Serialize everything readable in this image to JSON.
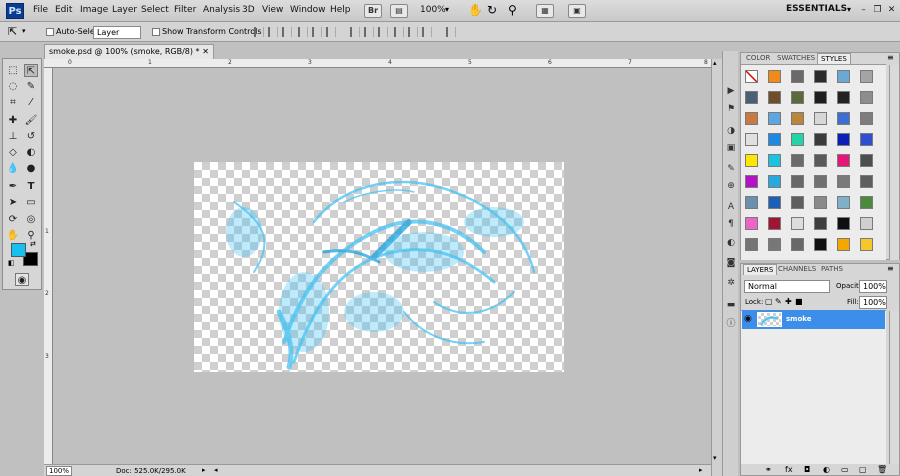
{
  "app": {
    "logo": "Ps"
  },
  "menus": [
    "File",
    "Edit",
    "Image",
    "Layer",
    "Select",
    "Filter",
    "Analysis",
    "3D",
    "View",
    "Window",
    "Help"
  ],
  "appbar": {
    "bridge": "Br",
    "zoom": "100%",
    "workspace": "ESSENTIALS"
  },
  "window_controls": {
    "minimize": "–",
    "restore": "❐",
    "close": "✕"
  },
  "options": {
    "auto_select_label": "Auto-Select:",
    "auto_select_target": "Layer",
    "show_transform_label": "Show Transform Controls"
  },
  "document": {
    "tab_label": "smoke.psd @ 100% (smoke, RGB/8) *"
  },
  "ruler": {
    "h_ticks": [
      "0",
      "1",
      "2",
      "3",
      "4",
      "5",
      "6",
      "7",
      "8"
    ],
    "v_ticks": [
      "1",
      "2",
      "3"
    ]
  },
  "status": {
    "zoom": "100%",
    "doc_info": "Doc: 525.0K/295.0K"
  },
  "panels": {
    "top_tabs": [
      "COLOR",
      "SWATCHES",
      "STYLES"
    ],
    "layer_tabs": [
      "LAYERS",
      "CHANNELS",
      "PATHS"
    ],
    "blend_mode": "Normal",
    "opacity_label": "Opacity:",
    "opacity_value": "100%",
    "lock_label": "Lock:",
    "fill_label": "Fill:",
    "fill_value": "100%",
    "layer_name": "smoke"
  },
  "colors": {
    "foreground": "#17c0f0",
    "background": "#000000",
    "selection": "#3d8ee8"
  },
  "styles_grid": [
    [
      "#ffffff",
      "#f28a1a",
      "#6a6a6a",
      "#2b2b2b",
      "#6aa9d6",
      "#a4a4a4"
    ],
    [
      "#4a5f74",
      "#6f4f2a",
      "#5b6a3a",
      "#1e1e1e",
      "#222222",
      "#8d8d8d"
    ],
    [
      "#c97a43",
      "#5ea6dd",
      "#b9863a",
      "#d7d7d7",
      "#3c6fd1",
      "#7d7d7d"
    ],
    [
      "#e0e0e0",
      "#1e88e5",
      "#22d4a8",
      "#3b3b3b",
      "#0a1fb8",
      "#2f4fd0"
    ],
    [
      "#ffe600",
      "#1cc2df",
      "#6b6b6b",
      "#5a5a5a",
      "#e5157a",
      "#4e4e4e"
    ],
    [
      "#b312c6",
      "#29a8dc",
      "#686868",
      "#707070",
      "#7a7a7a",
      "#5e5e5e"
    ],
    [
      "#6c8fae",
      "#1d5fb4",
      "#5f5f5f",
      "#8a8a8a",
      "#7fb0c8",
      "#4b8a3d"
    ],
    [
      "#ec64c5",
      "#9e1535",
      "#dcdcdc",
      "#3e3e3e",
      "#0f0f0f",
      "#d0d0d0"
    ],
    [
      "#747474",
      "#777777",
      "#686868",
      "#111111",
      "#f5a700",
      "#f4c72a"
    ]
  ]
}
